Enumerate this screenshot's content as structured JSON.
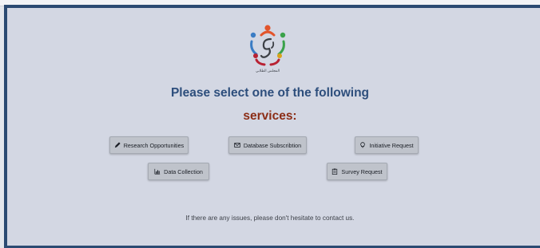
{
  "logo": {
    "caption": "المجلس الطلابي",
    "icon": "student-council-logo"
  },
  "heading": {
    "line1": "Please select one of the following",
    "line2": "services:"
  },
  "services": {
    "research": {
      "label": "Research Opportunities",
      "icon": "pencil-icon"
    },
    "database": {
      "label": "Database Subscribtion",
      "icon": "envelope-icon"
    },
    "initiative": {
      "label": "Initiative Request",
      "icon": "lightbulb-icon"
    },
    "data_collection": {
      "label": "Data Collection",
      "icon": "bar-chart-icon"
    },
    "survey": {
      "label": "Survey Request",
      "icon": "clipboard-icon"
    }
  },
  "footer": {
    "contact": "If there are any issues, please don't hesitate to contact us."
  },
  "colors": {
    "frame": "#2b4a72",
    "panel": "#d3d7e3",
    "heading_primary": "#2d4e7c",
    "heading_accent": "#8b2d16",
    "button": "#bfc3cb"
  }
}
